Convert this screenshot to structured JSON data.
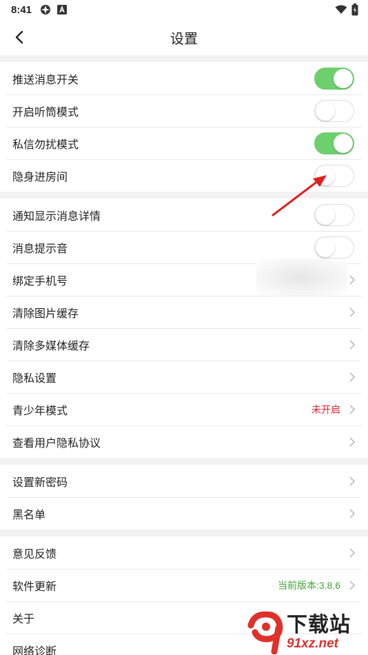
{
  "status": {
    "time": "8:41"
  },
  "header": {
    "title": "设置"
  },
  "colors": {
    "toggle_on": "#6ecf6e",
    "value_red": "#e8232b",
    "value_green": "#3fa535",
    "arrow": "#e02020"
  },
  "section1": [
    {
      "label": "推送消息开关",
      "toggle": true
    },
    {
      "label": "开启听筒模式",
      "toggle": false
    },
    {
      "label": "私信勿扰模式",
      "toggle": true
    },
    {
      "label": "隐身进房间",
      "toggle": false
    }
  ],
  "section2": [
    {
      "label": "通知显示消息详情",
      "toggle": false
    },
    {
      "label": "消息提示音",
      "toggle": false
    },
    {
      "label": "绑定手机号"
    },
    {
      "label": "清除图片缓存"
    },
    {
      "label": "清除多媒体缓存"
    },
    {
      "label": "隐私设置"
    },
    {
      "label": "青少年模式",
      "value": "未开启"
    },
    {
      "label": "查看用户隐私协议"
    }
  ],
  "section3": [
    {
      "label": "设置新密码"
    },
    {
      "label": "黑名单"
    }
  ],
  "section4": [
    {
      "label": "意见反馈"
    },
    {
      "label": "软件更新",
      "value": "当前版本:3.8.6"
    },
    {
      "label": "关于"
    },
    {
      "label": "网络诊断"
    }
  ],
  "watermark": {
    "big": "下载站",
    "small": "91xz.net"
  }
}
